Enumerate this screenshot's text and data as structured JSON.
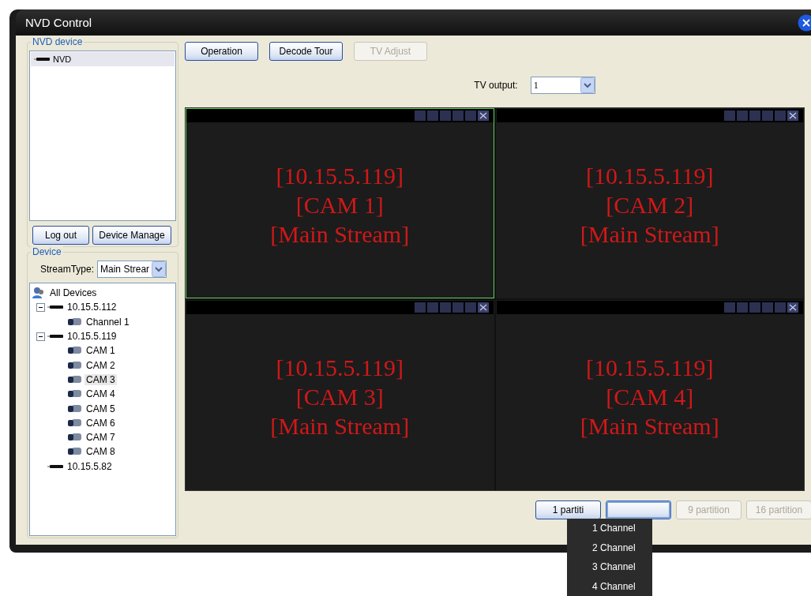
{
  "window": {
    "title": "NVD Control"
  },
  "nvd_device": {
    "legend": "NVD device",
    "items": [
      {
        "label": "NVD",
        "selected": true
      }
    ],
    "buttons": [
      {
        "label": "Log out",
        "disabled": false
      },
      {
        "label": "Device Manage",
        "disabled": false
      }
    ]
  },
  "device": {
    "legend": "Device",
    "stream_type": {
      "label": "StreamType:",
      "value": "Main Strear"
    },
    "tree": [
      {
        "label": "All Devices",
        "kind": "group",
        "selected": false,
        "children": [
          {
            "label": "10.15.5.112",
            "kind": "device",
            "selected": false,
            "expanded": true,
            "children": [
              {
                "label": "Channel 1",
                "kind": "camera",
                "selected": false
              }
            ]
          },
          {
            "label": "10.15.5.119",
            "kind": "device",
            "selected": false,
            "expanded": true,
            "children": [
              {
                "label": "CAM 1",
                "kind": "camera",
                "selected": false
              },
              {
                "label": "CAM 2",
                "kind": "camera",
                "selected": false
              },
              {
                "label": "CAM 3",
                "kind": "camera",
                "selected": true
              },
              {
                "label": "CAM 4",
                "kind": "camera",
                "selected": false
              },
              {
                "label": "CAM 5",
                "kind": "camera",
                "selected": false
              },
              {
                "label": "CAM 6",
                "kind": "camera",
                "selected": false
              },
              {
                "label": "CAM 7",
                "kind": "camera",
                "selected": false
              },
              {
                "label": "CAM 8",
                "kind": "camera",
                "selected": false
              }
            ]
          },
          {
            "label": "10.15.5.82",
            "kind": "device",
            "selected": false
          }
        ]
      }
    ]
  },
  "top_buttons": [
    {
      "label": "Operation",
      "disabled": false
    },
    {
      "label": "Decode Tour",
      "disabled": false
    },
    {
      "label": "TV Adjust",
      "disabled": true
    }
  ],
  "tv_output": {
    "label": "TV output:",
    "value": "1"
  },
  "video_cells": [
    {
      "selected": true,
      "lines": [
        "[10.15.5.119]",
        "[CAM 1]",
        "[Main Stream]"
      ]
    },
    {
      "selected": false,
      "lines": [
        "[10.15.5.119]",
        "[CAM 2]",
        "[Main Stream]"
      ]
    },
    {
      "selected": false,
      "lines": [
        "[10.15.5.119]",
        "[CAM 3]",
        "[Main Stream]"
      ]
    },
    {
      "selected": false,
      "lines": [
        "[10.15.5.119]",
        "[CAM 4]",
        "[Main Stream]"
      ]
    }
  ],
  "partition_buttons": [
    {
      "label": "1 partiti",
      "disabled": false,
      "selected": false
    },
    {
      "disabled": false,
      "selected": true
    },
    {
      "label": "9 partition",
      "disabled": true,
      "selected": false
    },
    {
      "label": "16 partition",
      "disabled": true,
      "selected": false
    }
  ],
  "channel_menu": {
    "items": [
      "1 Channel",
      "2 Channel",
      "3 Channel",
      "4 Channel"
    ]
  }
}
